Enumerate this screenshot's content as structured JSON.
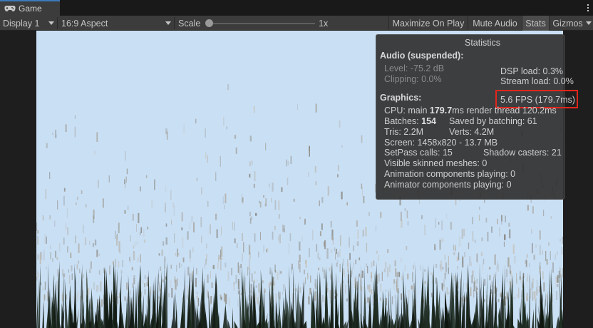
{
  "tab": {
    "label": "Game",
    "icon": "gamepad-icon"
  },
  "toolbar": {
    "display": "Display 1",
    "aspect": "16:9 Aspect",
    "scale_label": "Scale",
    "scale_value": "1x",
    "scale_level": 0,
    "maximize_on_play": "Maximize On Play",
    "mute_audio": "Mute Audio",
    "stats": "Stats",
    "gizmos": "Gizmos"
  },
  "statistics": {
    "title": "Statistics",
    "audio_header": "Audio (suspended):",
    "level": "Level: -75.2 dB",
    "clipping": "Clipping: 0.0%",
    "dsp_load": "DSP load: 0.3%",
    "stream_load": "Stream load: 0.0%",
    "graphics_header": "Graphics:",
    "fps": "5.6 FPS (179.7ms)",
    "cpu_prefix": "CPU: main ",
    "cpu_main": "179.7",
    "cpu_suffix": "ms  render thread 120.2ms",
    "batches_prefix": "Batches: ",
    "batches": "154",
    "saved_by_batching": "Saved by batching: 61",
    "tris": "Tris: 2.2M",
    "verts": "Verts: 4.2M",
    "screen": "Screen: 1458x820 - 13.7 MB",
    "setpass": "SetPass calls: 15",
    "shadow_casters": "Shadow casters: 21",
    "visible_skinned": "Visible skinned meshes: 0",
    "animation_components": "Animation components playing: 0",
    "animator_components": "Animator components playing: 0"
  },
  "colors": {
    "sky": "#c9dff4",
    "grass_dark": "#1a2a1a",
    "highlight": "#e0261c",
    "accent": "#3a79bb"
  }
}
